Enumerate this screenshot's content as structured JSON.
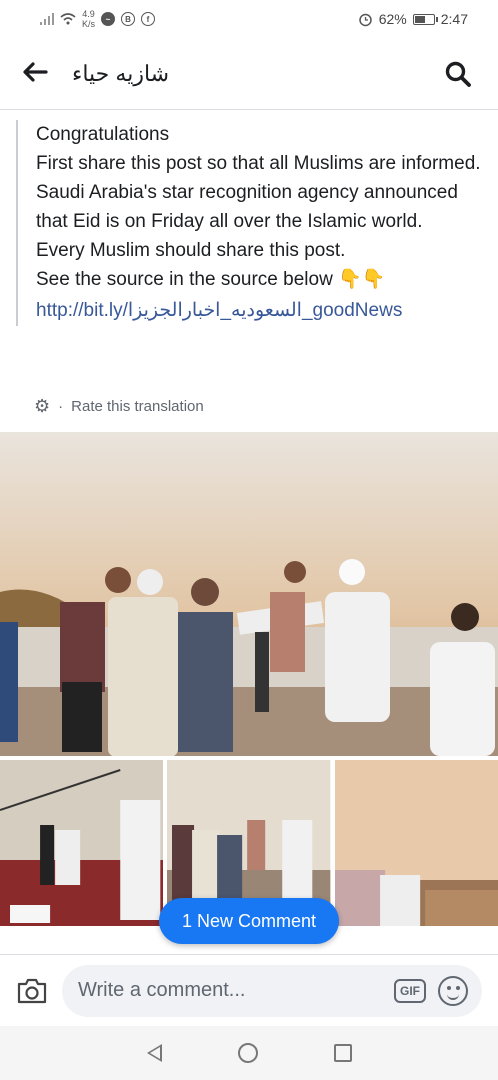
{
  "status_bar": {
    "net_speed_value": "4.9",
    "net_speed_unit": "K/s",
    "battery": "62%",
    "battery_level": 0.62,
    "time": "2:47"
  },
  "header": {
    "title": "شازيه حياء",
    "back_icon": "arrow-left-icon",
    "search_icon": "search-icon"
  },
  "post": {
    "lines": [
      "Congratulations",
      "First share this post so that all Muslims are informed.",
      "Saudi Arabia's star recognition agency announced that Eid is on Friday all over the Islamic world.",
      "Every Muslim should share this post.",
      "See the source in the source below 👇👇"
    ],
    "link": "http://bit.ly/السعوديه_اخبارالجزيزا_goodNews",
    "rate_translation": "Rate this translation"
  },
  "new_comment_button": "1 New Comment",
  "composer": {
    "placeholder": "Write a comment...",
    "gif_label": "GIF"
  },
  "colors": {
    "accent": "#1877f2",
    "link": "#385898",
    "text": "#1c1e21",
    "muted": "#606770"
  }
}
